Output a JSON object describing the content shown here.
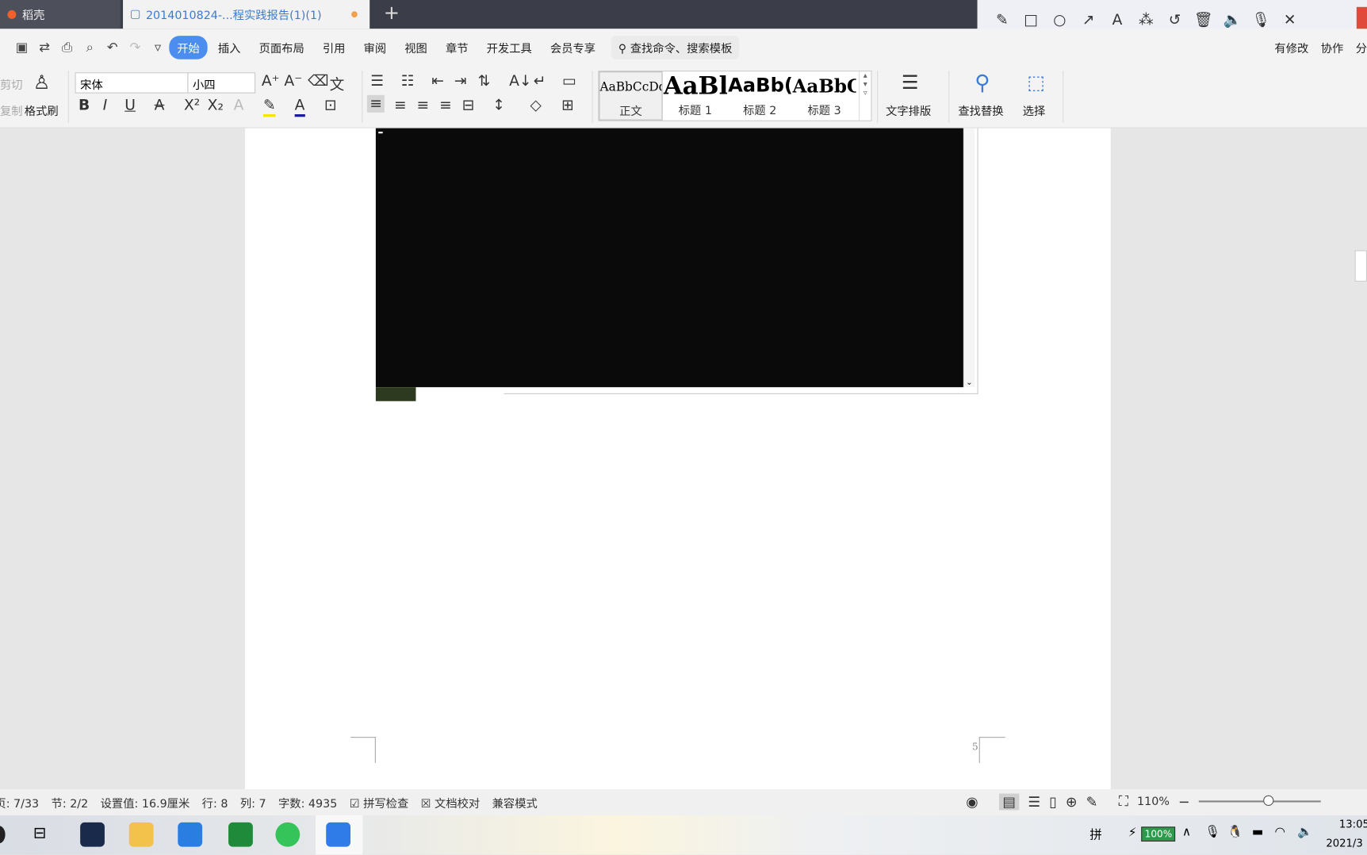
{
  "tabs": [
    {
      "label": "稻壳"
    },
    {
      "label": "2014010824-...程实践报告(1)(1)"
    }
  ],
  "annotation_tools": [
    "pencil-icon",
    "rectangle-icon",
    "circle-icon",
    "arrow-icon",
    "text-icon",
    "magic-wand-icon",
    "undo-icon",
    "trash-icon",
    "speaker-icon",
    "microphone-icon",
    "close-icon"
  ],
  "menu": {
    "items": [
      "开始",
      "插入",
      "页面布局",
      "引用",
      "审阅",
      "视图",
      "章节",
      "开发工具",
      "会员专享"
    ],
    "active": "开始",
    "search": "查找命令、搜索模板",
    "right": [
      "有修改",
      "协作",
      "分"
    ]
  },
  "ribbon": {
    "cut": "剪切",
    "copy": "复制",
    "format_painter": "格式刷",
    "font": "宋体",
    "size": "小四",
    "styles": [
      {
        "preview": "AaBbCcDd",
        "label": "正文"
      },
      {
        "preview": "AaBl",
        "label": "标题 1"
      },
      {
        "preview": "AaBb(",
        "label": "标题 2"
      },
      {
        "preview": "AaBbC",
        "label": "标题 3"
      }
    ],
    "text_layout": "文字排版",
    "find_replace": "查找替换",
    "select": "选择"
  },
  "document": {
    "page_number": "5"
  },
  "status": {
    "page": "页: 7/33",
    "section": "节: 2/2",
    "setting": "设置值: 16.9厘米",
    "row": "行: 8",
    "col": "列: 7",
    "words": "字数: 4935",
    "spell": "拼写检查",
    "proof": "文档校对",
    "compat": "兼容模式",
    "zoom": "110%"
  },
  "taskbar": {
    "ime": "拼",
    "battery": "100%",
    "time": "13:05",
    "date": "2021/3"
  },
  "colors": {
    "accent": "#4c8ef0",
    "tab_active_text": "#3a7bd5"
  }
}
